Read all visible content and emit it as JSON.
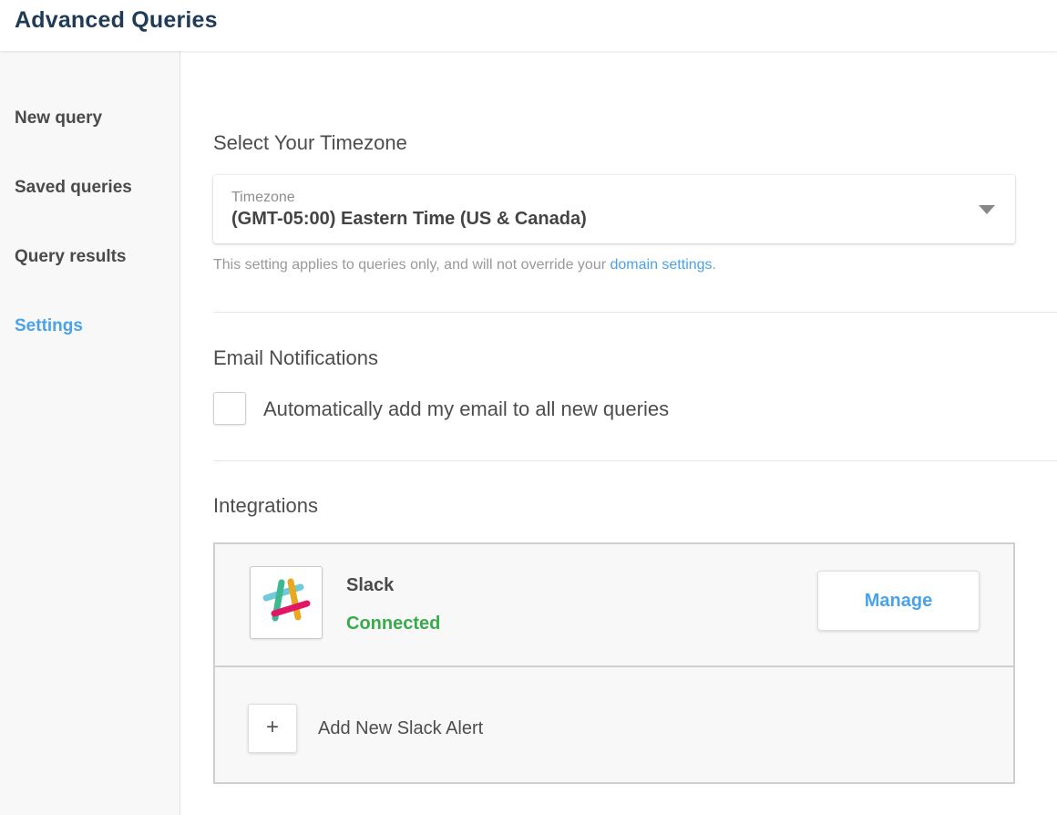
{
  "app": {
    "title": "Advanced Queries"
  },
  "sidebar": {
    "items": [
      {
        "label": "New query",
        "active": false
      },
      {
        "label": "Saved queries",
        "active": false
      },
      {
        "label": "Query results",
        "active": false
      },
      {
        "label": "Settings",
        "active": true
      }
    ]
  },
  "timezone": {
    "section_title": "Select Your Timezone",
    "field_label": "Timezone",
    "selected_value": "(GMT-05:00) Eastern Time (US & Canada)",
    "help_text_prefix": "This setting applies to queries only, and will not override your ",
    "help_link_text": "domain settings",
    "help_text_suffix": "."
  },
  "email_notifications": {
    "section_title": "Email Notifications",
    "checkbox_label": "Automatically add my email to all new queries",
    "checked": false
  },
  "integrations": {
    "section_title": "Integrations",
    "slack": {
      "name": "Slack",
      "status": "Connected",
      "manage_label": "Manage"
    },
    "add_alert": {
      "button_symbol": "+",
      "label": "Add New Slack Alert"
    }
  },
  "colors": {
    "header_title": "#1f3b58",
    "accent_blue": "#4aa3e8",
    "connected_green": "#3aab4a"
  }
}
